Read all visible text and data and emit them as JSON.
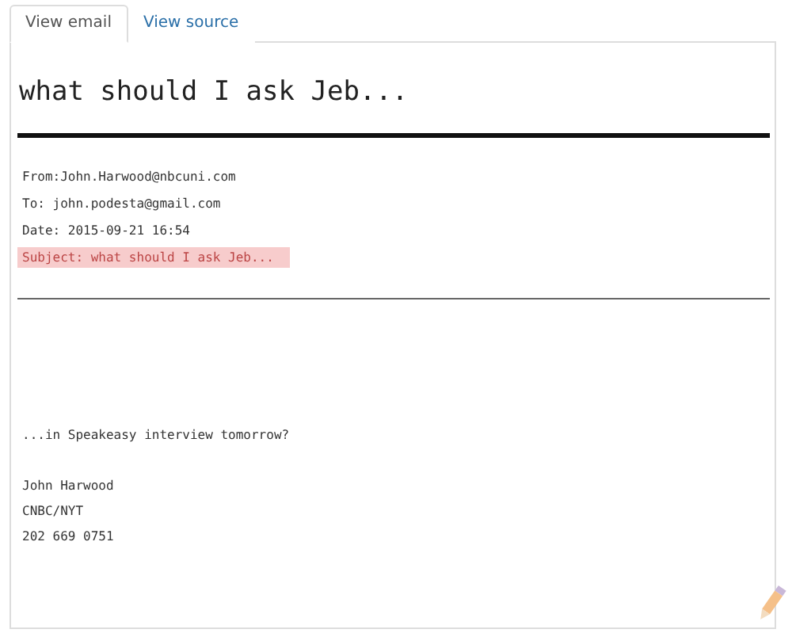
{
  "tabs": [
    {
      "label": "View email",
      "selected": true
    },
    {
      "label": "View source",
      "selected": false
    }
  ],
  "email": {
    "title": "what should I ask Jeb...",
    "headers": [
      {
        "text": "From:John.Harwood@nbcuni.com",
        "highlighted": false
      },
      {
        "text": "To: john.podesta@gmail.com",
        "highlighted": false
      },
      {
        "text": "Date: 2015-09-21 16:54",
        "highlighted": false
      },
      {
        "text": "Subject: what should I ask Jeb...",
        "highlighted": true
      }
    ],
    "message": "...in Speakeasy interview tomorrow?",
    "signature": [
      "John Harwood",
      "CNBC/NYT",
      "202 669 0751"
    ]
  }
}
